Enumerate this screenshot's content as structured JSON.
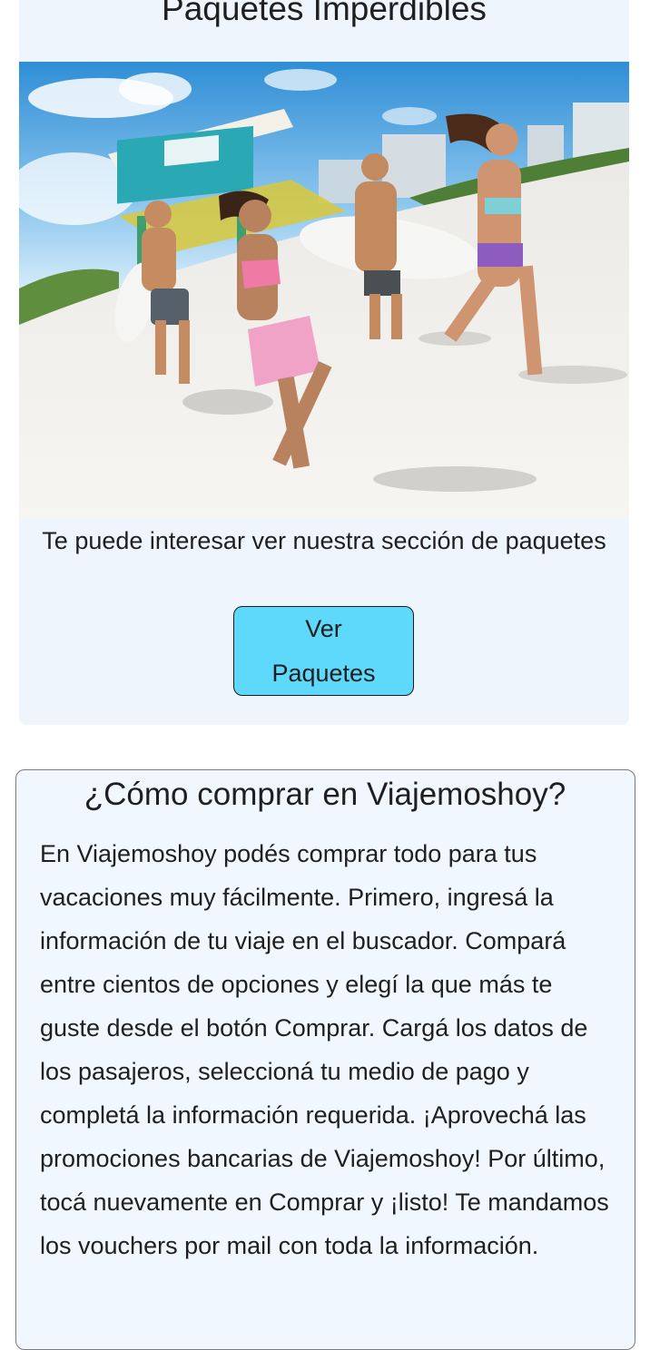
{
  "promo": {
    "title": "Paquetes Imperdibles",
    "image_alt": "Amigos corriendo en la playa con tablas de surf",
    "text": "Te puede interesar ver nuestra sección de paquetes",
    "button_label": "Ver Paquetes"
  },
  "howto": {
    "title": "¿Cómo comprar en Viajemoshoy?",
    "body": "En Viajemoshoy podés comprar todo para tus vacaciones muy fácilmente. Primero, ingresá la información de tu viaje en el buscador. Compará entre cientos de opciones y elegí la que más te guste desde el botón Comprar. Cargá los datos de los pasajeros, seleccioná tu medio de pago y completá la información requerida. ¡Aprovechá las promociones bancarias de Viajemoshoy! Por último, tocá nuevamente en Comprar y ¡listo! Te mandamos los vouchers por mail con toda la información."
  },
  "colors": {
    "card_background": "#eef5fc",
    "button_background": "#5ed9fb",
    "text": "#1f1f1f"
  }
}
